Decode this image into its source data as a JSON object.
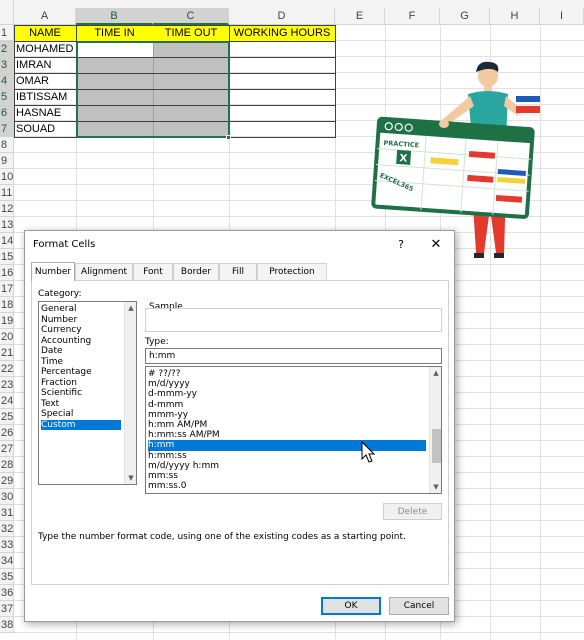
{
  "spreadsheet": {
    "columns": [
      "A",
      "B",
      "C",
      "D",
      "E",
      "F",
      "G",
      "H",
      "I"
    ],
    "rows": [
      "1",
      "2",
      "3",
      "4",
      "5",
      "6",
      "7",
      "8",
      "9",
      "10",
      "11",
      "12",
      "13",
      "14",
      "15",
      "16",
      "17",
      "18",
      "19",
      "20",
      "21",
      "22",
      "23",
      "24",
      "25",
      "26",
      "27",
      "28",
      "29",
      "30",
      "31",
      "32",
      "33",
      "34",
      "35",
      "36",
      "37",
      "38"
    ],
    "headers": {
      "name": "NAME",
      "time_in": "TIME IN",
      "time_out": "TIME OUT",
      "working_hours": "WORKING HOURS"
    },
    "names": [
      "MOHAMED",
      "IMRAN",
      "OMAR",
      "IBTISSAM",
      "HASNAE",
      "SOUAD"
    ],
    "colors": {
      "header_fill": "#ffff00",
      "selected_fill": "#c0c0c0",
      "selection_border": "#217346"
    }
  },
  "illustration": {
    "brand_line1": "PRACTICE",
    "brand_line2": "EXCEL365",
    "logo_letter": "X",
    "colors": {
      "board_border": "#1e7145",
      "shirt": "#2aa6a0",
      "pants": "#e33a2c",
      "accent_red": "#e33a2c",
      "accent_yellow": "#f5d23a",
      "accent_blue": "#1e5bb8"
    }
  },
  "dialog": {
    "title": "Format Cells",
    "help_icon": "?",
    "close_icon": "✕",
    "tabs": [
      "Number",
      "Alignment",
      "Font",
      "Border",
      "Fill",
      "Protection"
    ],
    "active_tab": "Number",
    "category_label": "Category:",
    "categories": [
      "General",
      "Number",
      "Currency",
      "Accounting",
      "Date",
      "Time",
      "Percentage",
      "Fraction",
      "Scientific",
      "Text",
      "Special",
      "Custom"
    ],
    "selected_category": "Custom",
    "sample_label": "Sample",
    "type_label": "Type:",
    "type_value": "h:mm",
    "types": [
      "# ??/??",
      "m/d/yyyy",
      "d-mmm-yy",
      "d-mmm",
      "mmm-yy",
      "h:mm AM/PM",
      "h:mm:ss AM/PM",
      "h:mm",
      "h:mm:ss",
      "m/d/yyyy h:mm",
      "mm:ss",
      "mm:ss.0"
    ],
    "selected_type": "h:mm",
    "delete_label": "Delete",
    "hint": "Type the number format code, using one of the existing codes as a starting point.",
    "ok_label": "OK",
    "cancel_label": "Cancel",
    "scroll_up_icon": "▲",
    "scroll_down_icon": "▼"
  }
}
